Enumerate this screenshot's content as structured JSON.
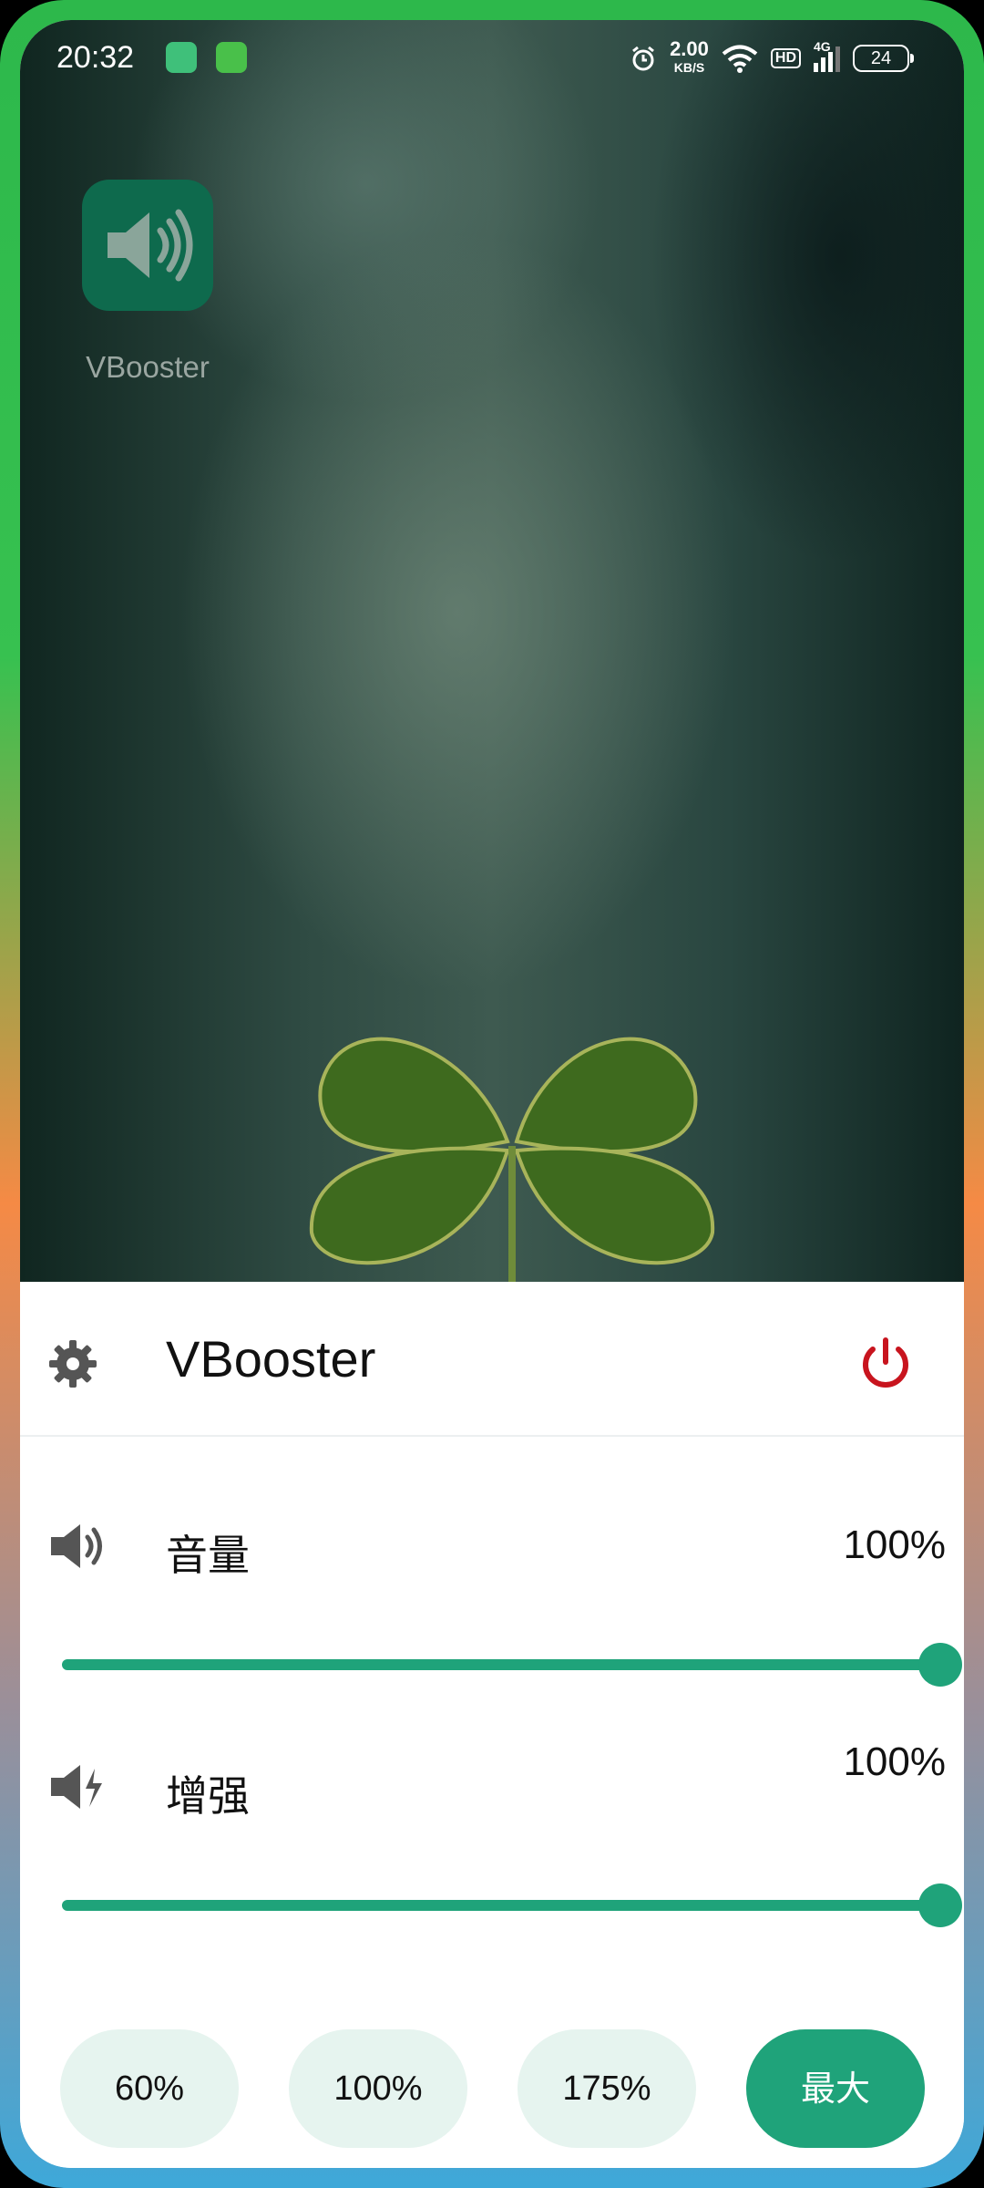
{
  "status_bar": {
    "time": "20:32",
    "net_speed": "2.00",
    "net_speed_unit": "KB/S",
    "hd_badge": "HD",
    "network_type": "4G",
    "battery": "24"
  },
  "desktop": {
    "app_label": "VBooster"
  },
  "panel": {
    "title": "VBooster",
    "volume": {
      "label": "音量",
      "value_text": "100%",
      "level": 1.0
    },
    "boost": {
      "label": "增强",
      "value_text": "100%",
      "level": 1.0
    },
    "presets": [
      "60%",
      "100%",
      "175%",
      "最大"
    ]
  },
  "colors": {
    "accent": "#1fa37a",
    "power": "#c8141e",
    "icon_gray": "#555555"
  }
}
